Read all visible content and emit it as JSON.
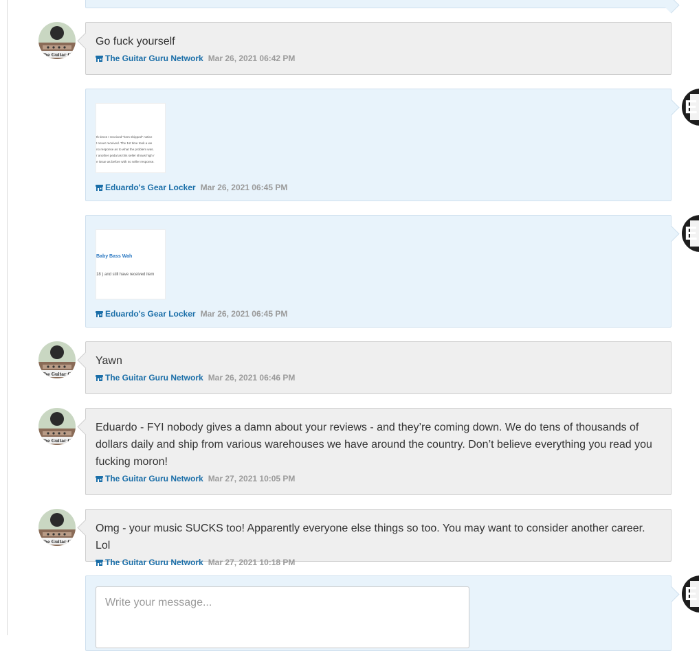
{
  "colors": {
    "link": "#1a6ea8",
    "timestamp": "#9a9a9a",
    "their_bubble": "#efefef",
    "my_bubble": "#e8f3fb"
  },
  "avatars": {
    "guru_logo_text": "The Guitar Gu",
    "eduardo_initial": "E"
  },
  "messages": [
    {
      "side": "theirs",
      "text": "Go fuck yourself",
      "sender": "The Guitar Guru Network",
      "time": "Mar 26, 2021 06:42 PM"
    },
    {
      "side": "mine",
      "attachment": "image-thumbnail",
      "sender": "Eduardo's Gear Locker",
      "time": "Mar 26, 2021 06:45 PM",
      "thumb_lines": [
        "th times I received \"item shipped\" notice",
        "t never received. The 1st time took a we",
        "no response as to what the problem was.",
        "r another pedal as this seller shows high r",
        "e issue as before with no seller response."
      ]
    },
    {
      "side": "mine",
      "attachment": "image-thumbnail",
      "sender": "Eduardo's Gear Locker",
      "time": "Mar 26, 2021 06:45 PM",
      "thumb_title": "Baby Bass Wah",
      "thumb_sub": "18 ) and still have received item"
    },
    {
      "side": "theirs",
      "text": "Yawn",
      "sender": "The Guitar Guru Network",
      "time": "Mar 26, 2021 06:46 PM"
    },
    {
      "side": "theirs",
      "text": "Eduardo - FYI nobody gives a damn about your reviews - and they’re coming down. We do tens of thousands of dollars daily and ship from various warehouses we have around the country. Don’t believe everything you read you fucking moron!",
      "sender": "The Guitar Guru Network",
      "time": "Mar 27, 2021 10:05 PM"
    },
    {
      "side": "theirs",
      "text": "Omg - your music SUCKS too! Apparently everyone else things so too. You may want to consider another career. Lol",
      "sender": "The Guitar Guru Network",
      "time": "Mar 27, 2021 10:18 PM"
    }
  ],
  "compose": {
    "placeholder": "Write your message...",
    "value": ""
  },
  "icons": {
    "shop": "shop-icon"
  }
}
